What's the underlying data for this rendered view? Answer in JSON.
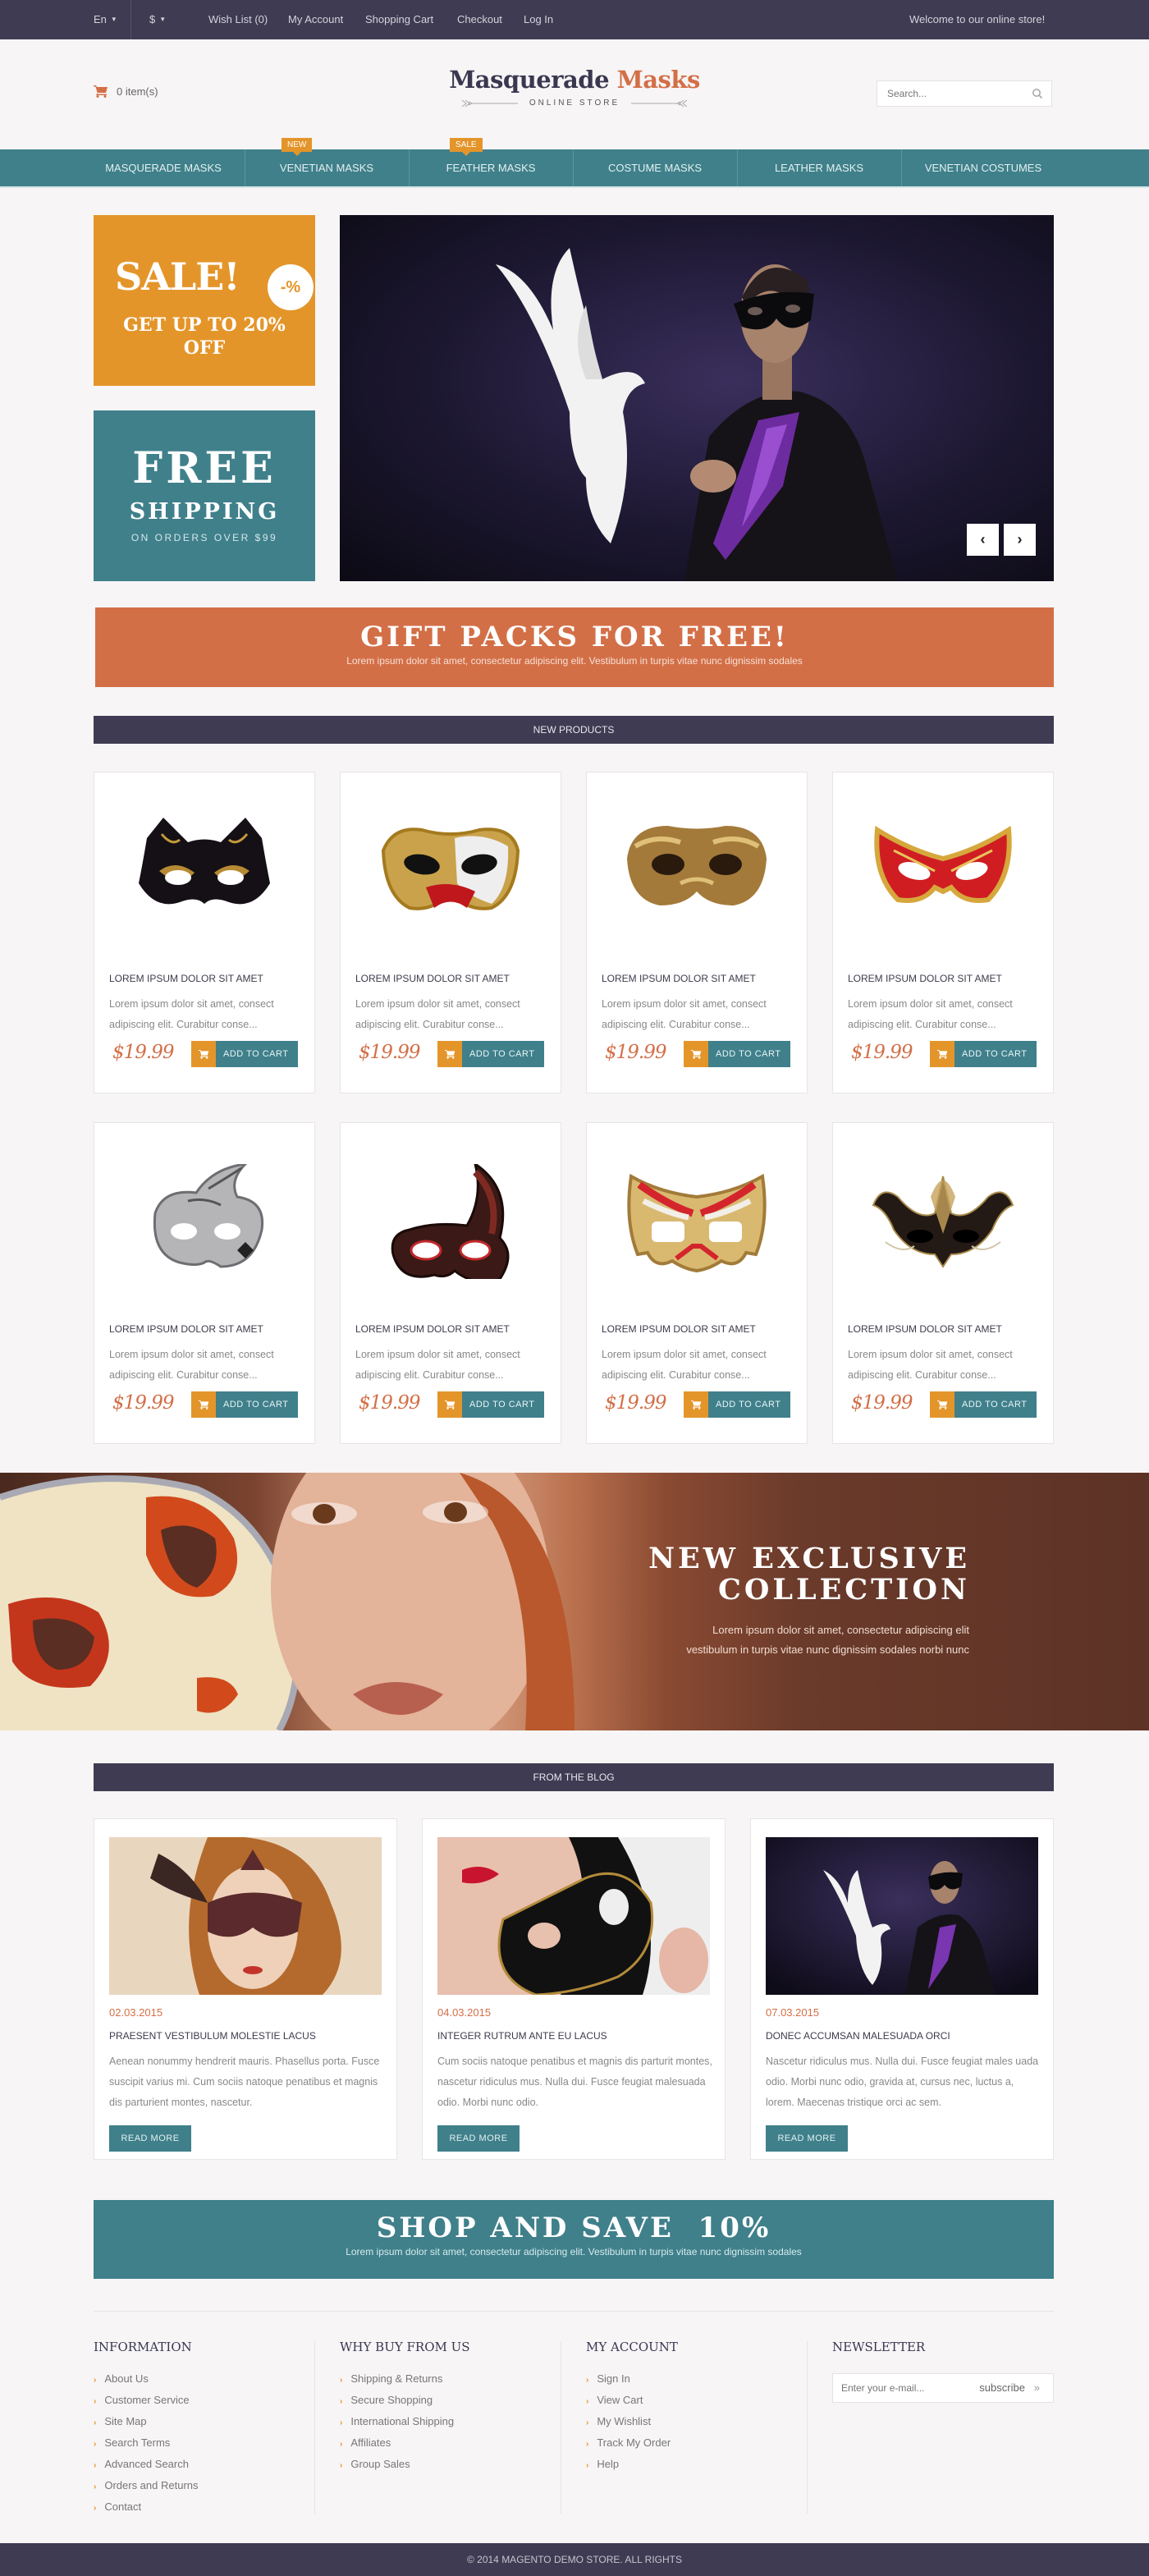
{
  "topbar": {
    "language": "En",
    "currency": "$",
    "links": [
      "Wish List (0)",
      "My Account",
      "Shopping Cart",
      "Checkout",
      "Log In"
    ],
    "welcome": "Welcome to our online store!"
  },
  "header": {
    "cart_summary": "0 item(s)",
    "logo_primary": "Masquerade",
    "logo_accent": "Masks",
    "logo_tagline": "ONLINE STORE",
    "search_placeholder": "Search..."
  },
  "nav": {
    "items": [
      {
        "label": "MASQUERADE MASKS",
        "badge": null
      },
      {
        "label": "VENETIAN MASKS",
        "badge": "NEW"
      },
      {
        "label": "FEATHER MASKS",
        "badge": "SALE"
      },
      {
        "label": "COSTUME MASKS",
        "badge": null
      },
      {
        "label": "LEATHER MASKS",
        "badge": null
      },
      {
        "label": "VENETIAN COSTUMES",
        "badge": null
      }
    ]
  },
  "promos": {
    "sale_title": "SALE!",
    "sale_badge": "-%",
    "sale_line1": "GET UP TO 20%",
    "sale_line2": "OFF",
    "ship_title": "FREE",
    "ship_subtitle": "SHIPPING",
    "ship_note": "ON ORDERS OVER $99"
  },
  "slider": {
    "prev_icon": "chevron-left-icon",
    "next_icon": "chevron-right-icon"
  },
  "gift_banner": {
    "title": "GIFT PACKS FOR FREE!",
    "subtitle": "Lorem ipsum dolor sit amet, consectetur adipiscing elit. Vestibulum in turpis vitae nunc dignissim sodales"
  },
  "new_products": {
    "heading": "NEW PRODUCTS",
    "add_to_cart_label": "ADD TO CART",
    "items": [
      {
        "name": "LOREM IPSUM DOLOR SIT AMET",
        "desc": "Lorem ipsum dolor sit amet, consect adipiscing elit. Curabitur conse...",
        "price": "$19.99",
        "mask": "black-gold-cat"
      },
      {
        "name": "LOREM IPSUM DOLOR SIT AMET",
        "desc": "Lorem ipsum dolor sit amet, consect adipiscing elit. Curabitur conse...",
        "price": "$19.99",
        "mask": "gold-red-music"
      },
      {
        "name": "LOREM IPSUM DOLOR SIT AMET",
        "desc": "Lorem ipsum dolor sit amet, consect adipiscing elit. Curabitur conse...",
        "price": "$19.99",
        "mask": "gold-baroque"
      },
      {
        "name": "LOREM IPSUM DOLOR SIT AMET",
        "desc": "Lorem ipsum dolor sit amet, consect adipiscing elit. Curabitur conse...",
        "price": "$19.99",
        "mask": "red-gold-cat"
      },
      {
        "name": "LOREM IPSUM DOLOR SIT AMET",
        "desc": "Lorem ipsum dolor sit amet, consect adipiscing elit. Curabitur conse...",
        "price": "$19.99",
        "mask": "silver-ornate"
      },
      {
        "name": "LOREM IPSUM DOLOR SIT AMET",
        "desc": "Lorem ipsum dolor sit amet, consect adipiscing elit. Curabitur conse...",
        "price": "$19.99",
        "mask": "jester-red-black"
      },
      {
        "name": "LOREM IPSUM DOLOR SIT AMET",
        "desc": "Lorem ipsum dolor sit amet, consect adipiscing elit. Curabitur conse...",
        "price": "$19.99",
        "mask": "gold-red-white"
      },
      {
        "name": "LOREM IPSUM DOLOR SIT AMET",
        "desc": "Lorem ipsum dolor sit amet, consect adipiscing elit. Curabitur conse...",
        "price": "$19.99",
        "mask": "filigree-black-gold"
      }
    ]
  },
  "collection": {
    "title_line1": "NEW EXCLUSIVE",
    "title_line2": "COLLECTION",
    "text_line1": "Lorem ipsum dolor sit amet, consectetur adipiscing elit",
    "text_line2": "vestibulum in turpis vitae nunc dignissim sodales norbi nunc"
  },
  "blog": {
    "heading": "FROM THE BLOG",
    "read_more_label": "READ MORE",
    "posts": [
      {
        "date": "02.03.2015",
        "title": "PRAESENT VESTIBULUM MOLESTIE LACUS",
        "text": "Aenean nonummy hendrerit mauris. Phasellus porta. Fusce suscipit varius mi. Cum sociis natoque penatibus et magnis dis parturient montes, nascetur."
      },
      {
        "date": "04.03.2015",
        "title": "INTEGER RUTRUM ANTE EU LACUS",
        "text": "Cum sociis natoque penatibus et magnis dis parturit montes, nascetur ridiculus mus. Nulla dui. Fusce feugiat malesuada odio. Morbi nunc odio."
      },
      {
        "date": "07.03.2015",
        "title": "DONEC ACCUMSAN MALESUADA ORCI",
        "text": "Nascetur ridiculus mus. Nulla dui. Fusce feugiat males uada odio. Morbi nunc odio, gravida at, cursus nec, luctus a, lorem. Maecenas tristique orci ac sem."
      }
    ]
  },
  "save_banner": {
    "title": "SHOP AND SAVE  10%",
    "subtitle": "Lorem ipsum dolor sit amet, consectetur adipiscing elit. Vestibulum in turpis vitae nunc dignissim sodales"
  },
  "footer": {
    "columns": [
      {
        "heading": "INFORMATION",
        "links": [
          "About Us",
          "Customer Service",
          "Site Map",
          "Search Terms",
          "Advanced Search",
          "Orders and Returns",
          "Contact"
        ]
      },
      {
        "heading": "WHY BUY FROM US",
        "links": [
          "Shipping & Returns",
          "Secure Shopping",
          "International Shipping",
          "Affiliates",
          "Group Sales"
        ]
      },
      {
        "heading": "MY ACCOUNT",
        "links": [
          "Sign In",
          "View Cart",
          "My Wishlist",
          "Track My Order",
          "Help"
        ]
      }
    ],
    "newsletter": {
      "heading": "NEWSLETTER",
      "placeholder": "Enter your e-mail...",
      "button_label": "subscribe",
      "button_icon": "double-chevron-right-icon"
    },
    "copyright": "© 2014 MAGENTO DEMO STORE. ALL RIGHTS"
  },
  "colors": {
    "dark": "#3e3b52",
    "teal": "#3f808b",
    "orange": "#e4952a",
    "coral": "#d36f47",
    "page_bg": "#f7f5f6"
  }
}
